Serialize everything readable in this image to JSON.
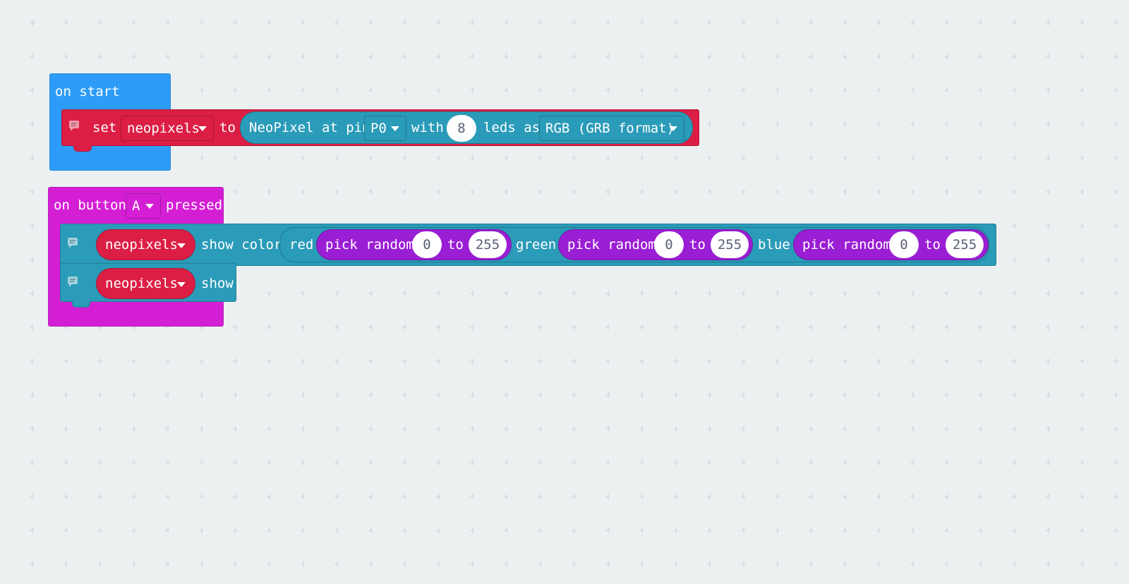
{
  "colors": {
    "workspace_bg": "#ecf0f1",
    "on_start": "#2d9cf8",
    "button_event": "#d41ed4",
    "neopixel_red": "#dc1e44",
    "neopixel_teal": "#2a9bb8",
    "math_purple": "#9a1ed4"
  },
  "on_start": {
    "label": "on start",
    "set_block": {
      "set_label": "set",
      "variable": "neopixels",
      "to_label": "to",
      "create": {
        "prefix": "NeoPixel at pin",
        "pin": "P0",
        "with_label": "with",
        "count": "8",
        "leds_as_label": "leds as",
        "mode": "RGB (GRB format)"
      }
    }
  },
  "on_button": {
    "on_button_label": "on button",
    "button": "A",
    "pressed_label": "pressed",
    "show_color_block": {
      "strip": "neopixels",
      "label": "show color",
      "red_label": "red",
      "green_label": "green",
      "blue_label": "blue",
      "pick_random_label": "pick random",
      "to_label": "to",
      "red_min": "0",
      "red_max": "255",
      "green_min": "0",
      "green_max": "255",
      "blue_min": "0",
      "blue_max": "255"
    },
    "show_block": {
      "strip": "neopixels",
      "label": "show"
    }
  },
  "icons": [
    "comment-icon",
    "dropdown-caret-icon"
  ]
}
